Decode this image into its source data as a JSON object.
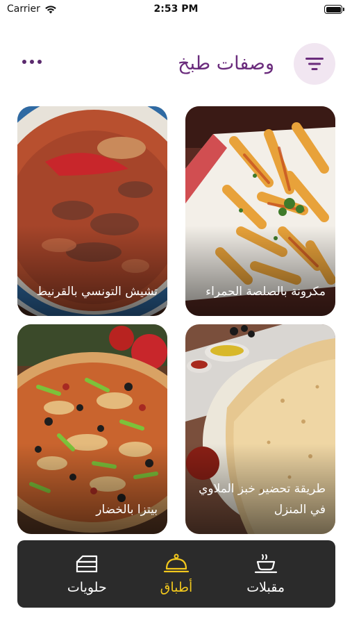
{
  "status_bar": {
    "carrier": "Carrier",
    "time": "2:53 PM",
    "icons": [
      "wifi-icon",
      "battery-icon"
    ]
  },
  "header": {
    "title": "وصفات طبخ",
    "filter_icon": "filter-icon",
    "more_icon": "more-horizontal-icon"
  },
  "recipes": [
    {
      "title": "مكرونة بالصلصة الحمراء",
      "image": "penne-pasta-tomato-sauce"
    },
    {
      "title": "تشيش التونسي بالقرنيط",
      "image": "tunisian-stew"
    },
    {
      "title": "طريقة تحضير خبز الملاوي في المنزل",
      "image": "malawi-flatbread"
    },
    {
      "title": "بيتزا بالخضار",
      "image": "vegetable-pizza"
    }
  ],
  "tabs": [
    {
      "label": "مقبلات",
      "icon": "cup-icon",
      "active": false
    },
    {
      "label": "أطباق",
      "icon": "cloche-icon",
      "active": true
    },
    {
      "label": "حلويات",
      "icon": "cake-icon",
      "active": false
    }
  ],
  "colors": {
    "title": "#6a2b7c",
    "filter_bg": "#f1e6f1",
    "tab_bar_bg": "#2b2b2b",
    "tab_active": "#f2c81d",
    "tab_inactive": "#ffffff"
  }
}
